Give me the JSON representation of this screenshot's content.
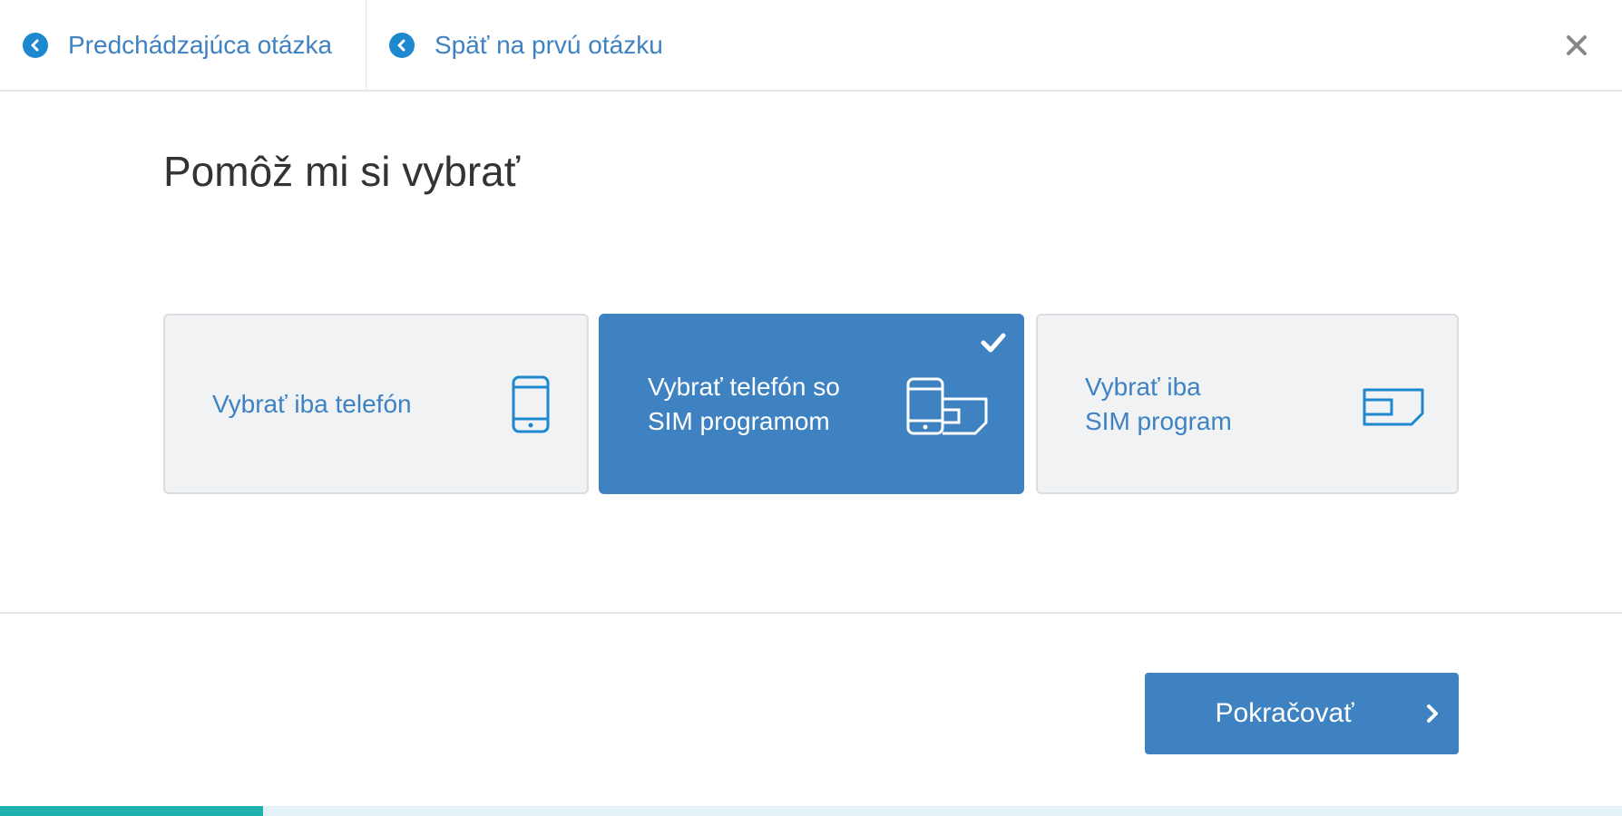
{
  "topbar": {
    "previous_label": "Predchádzajúca otázka",
    "first_label": "Späť na prvú otázku"
  },
  "title": "Pomôž mi si vybrať",
  "options": [
    {
      "label": "Vybrať iba telefón",
      "icon": "phone-icon",
      "selected": false
    },
    {
      "label": "Vybrať telefón so\nSIM programom",
      "icon": "phone-sim-icon",
      "selected": true
    },
    {
      "label": "Vybrať iba\nSIM program",
      "icon": "sim-card-icon",
      "selected": false
    }
  ],
  "continue_label": "Pokračovať",
  "progress": 0.162,
  "colors": {
    "accent": "#3f82c2",
    "link": "#3f82c2",
    "progress_fill": "#1fb2ac",
    "progress_track": "#e4f1f7",
    "option_bg": "#f0f2f4"
  }
}
